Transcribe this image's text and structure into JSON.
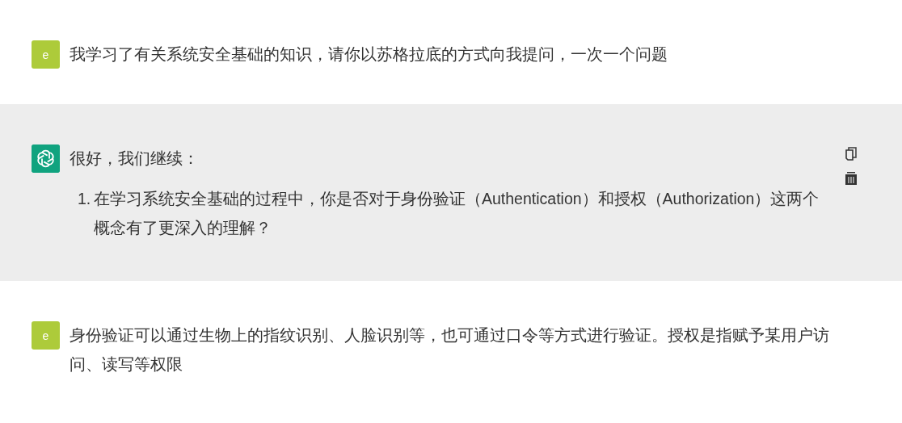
{
  "messages": [
    {
      "kind": "user",
      "avatar": "e",
      "paragraphs": [
        "我学习了有关系统安全基础的知识，请你以苏格拉底的方式向我提问，一次一个问题"
      ]
    },
    {
      "kind": "assistant",
      "paragraphs": [
        "很好，我们继续："
      ],
      "list": [
        {
          "number": "1.",
          "text": "在学习系统安全基础的过程中，你是否对于身份验证（Authentication）和授权（Authorization）这两个概念有了更深入的理解？"
        }
      ]
    },
    {
      "kind": "user",
      "avatar": "e",
      "paragraphs": [
        "身份验证可以通过生物上的指纹识别、人脸识别等，也可通过口令等方式进行验证。授权是指赋予某用户访问、读写等权限"
      ]
    }
  ]
}
